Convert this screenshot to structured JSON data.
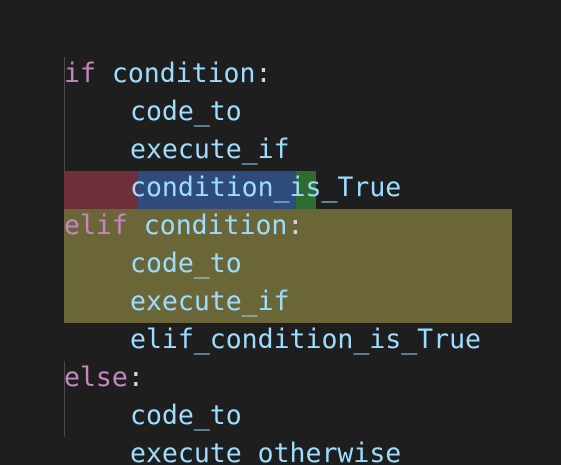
{
  "editor": {
    "language": "python",
    "colors": {
      "background": "#1e1e1e",
      "keyword": "#c586c0",
      "identifier": "#9cdcfe",
      "punctuation": "#d4d4d4",
      "highlight_elif_keyword": "#6e2f3b",
      "highlight_elif_condition": "#2f4b7c",
      "highlight_elif_colon": "#2e6b2f",
      "highlight_elif_body": "#6b6637"
    },
    "lines": [
      {
        "kw": "if",
        "rest": " condition",
        "punct": ":"
      },
      {
        "text": "code_to"
      },
      {
        "text": "execute_if"
      },
      {
        "text": "condition_is_True"
      },
      {
        "kw": "elif",
        "rest": " condition",
        "punct": ":"
      },
      {
        "text": "code_to"
      },
      {
        "text": "execute_if"
      },
      {
        "text": "elif_condition_is_True"
      },
      {
        "kw": "else",
        "punct": ":"
      },
      {
        "text": "code_to"
      },
      {
        "text": "execute_otherwise"
      }
    ]
  }
}
